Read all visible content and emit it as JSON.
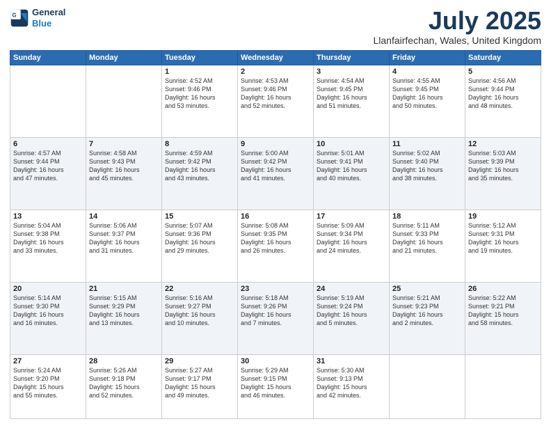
{
  "header": {
    "logo_line1": "General",
    "logo_line2": "Blue",
    "month": "July 2025",
    "location": "Llanfairfechan, Wales, United Kingdom"
  },
  "weekdays": [
    "Sunday",
    "Monday",
    "Tuesday",
    "Wednesday",
    "Thursday",
    "Friday",
    "Saturday"
  ],
  "weeks": [
    [
      {
        "day": "",
        "info": ""
      },
      {
        "day": "",
        "info": ""
      },
      {
        "day": "1",
        "info": "Sunrise: 4:52 AM\nSunset: 9:46 PM\nDaylight: 16 hours\nand 53 minutes."
      },
      {
        "day": "2",
        "info": "Sunrise: 4:53 AM\nSunset: 9:46 PM\nDaylight: 16 hours\nand 52 minutes."
      },
      {
        "day": "3",
        "info": "Sunrise: 4:54 AM\nSunset: 9:45 PM\nDaylight: 16 hours\nand 51 minutes."
      },
      {
        "day": "4",
        "info": "Sunrise: 4:55 AM\nSunset: 9:45 PM\nDaylight: 16 hours\nand 50 minutes."
      },
      {
        "day": "5",
        "info": "Sunrise: 4:56 AM\nSunset: 9:44 PM\nDaylight: 16 hours\nand 48 minutes."
      }
    ],
    [
      {
        "day": "6",
        "info": "Sunrise: 4:57 AM\nSunset: 9:44 PM\nDaylight: 16 hours\nand 47 minutes."
      },
      {
        "day": "7",
        "info": "Sunrise: 4:58 AM\nSunset: 9:43 PM\nDaylight: 16 hours\nand 45 minutes."
      },
      {
        "day": "8",
        "info": "Sunrise: 4:59 AM\nSunset: 9:42 PM\nDaylight: 16 hours\nand 43 minutes."
      },
      {
        "day": "9",
        "info": "Sunrise: 5:00 AM\nSunset: 9:42 PM\nDaylight: 16 hours\nand 41 minutes."
      },
      {
        "day": "10",
        "info": "Sunrise: 5:01 AM\nSunset: 9:41 PM\nDaylight: 16 hours\nand 40 minutes."
      },
      {
        "day": "11",
        "info": "Sunrise: 5:02 AM\nSunset: 9:40 PM\nDaylight: 16 hours\nand 38 minutes."
      },
      {
        "day": "12",
        "info": "Sunrise: 5:03 AM\nSunset: 9:39 PM\nDaylight: 16 hours\nand 35 minutes."
      }
    ],
    [
      {
        "day": "13",
        "info": "Sunrise: 5:04 AM\nSunset: 9:38 PM\nDaylight: 16 hours\nand 33 minutes."
      },
      {
        "day": "14",
        "info": "Sunrise: 5:06 AM\nSunset: 9:37 PM\nDaylight: 16 hours\nand 31 minutes."
      },
      {
        "day": "15",
        "info": "Sunrise: 5:07 AM\nSunset: 9:36 PM\nDaylight: 16 hours\nand 29 minutes."
      },
      {
        "day": "16",
        "info": "Sunrise: 5:08 AM\nSunset: 9:35 PM\nDaylight: 16 hours\nand 26 minutes."
      },
      {
        "day": "17",
        "info": "Sunrise: 5:09 AM\nSunset: 9:34 PM\nDaylight: 16 hours\nand 24 minutes."
      },
      {
        "day": "18",
        "info": "Sunrise: 5:11 AM\nSunset: 9:33 PM\nDaylight: 16 hours\nand 21 minutes."
      },
      {
        "day": "19",
        "info": "Sunrise: 5:12 AM\nSunset: 9:31 PM\nDaylight: 16 hours\nand 19 minutes."
      }
    ],
    [
      {
        "day": "20",
        "info": "Sunrise: 5:14 AM\nSunset: 9:30 PM\nDaylight: 16 hours\nand 16 minutes."
      },
      {
        "day": "21",
        "info": "Sunrise: 5:15 AM\nSunset: 9:29 PM\nDaylight: 16 hours\nand 13 minutes."
      },
      {
        "day": "22",
        "info": "Sunrise: 5:16 AM\nSunset: 9:27 PM\nDaylight: 16 hours\nand 10 minutes."
      },
      {
        "day": "23",
        "info": "Sunrise: 5:18 AM\nSunset: 9:26 PM\nDaylight: 16 hours\nand 7 minutes."
      },
      {
        "day": "24",
        "info": "Sunrise: 5:19 AM\nSunset: 9:24 PM\nDaylight: 16 hours\nand 5 minutes."
      },
      {
        "day": "25",
        "info": "Sunrise: 5:21 AM\nSunset: 9:23 PM\nDaylight: 16 hours\nand 2 minutes."
      },
      {
        "day": "26",
        "info": "Sunrise: 5:22 AM\nSunset: 9:21 PM\nDaylight: 15 hours\nand 58 minutes."
      }
    ],
    [
      {
        "day": "27",
        "info": "Sunrise: 5:24 AM\nSunset: 9:20 PM\nDaylight: 15 hours\nand 55 minutes."
      },
      {
        "day": "28",
        "info": "Sunrise: 5:26 AM\nSunset: 9:18 PM\nDaylight: 15 hours\nand 52 minutes."
      },
      {
        "day": "29",
        "info": "Sunrise: 5:27 AM\nSunset: 9:17 PM\nDaylight: 15 hours\nand 49 minutes."
      },
      {
        "day": "30",
        "info": "Sunrise: 5:29 AM\nSunset: 9:15 PM\nDaylight: 15 hours\nand 46 minutes."
      },
      {
        "day": "31",
        "info": "Sunrise: 5:30 AM\nSunset: 9:13 PM\nDaylight: 15 hours\nand 42 minutes."
      },
      {
        "day": "",
        "info": ""
      },
      {
        "day": "",
        "info": ""
      }
    ]
  ]
}
